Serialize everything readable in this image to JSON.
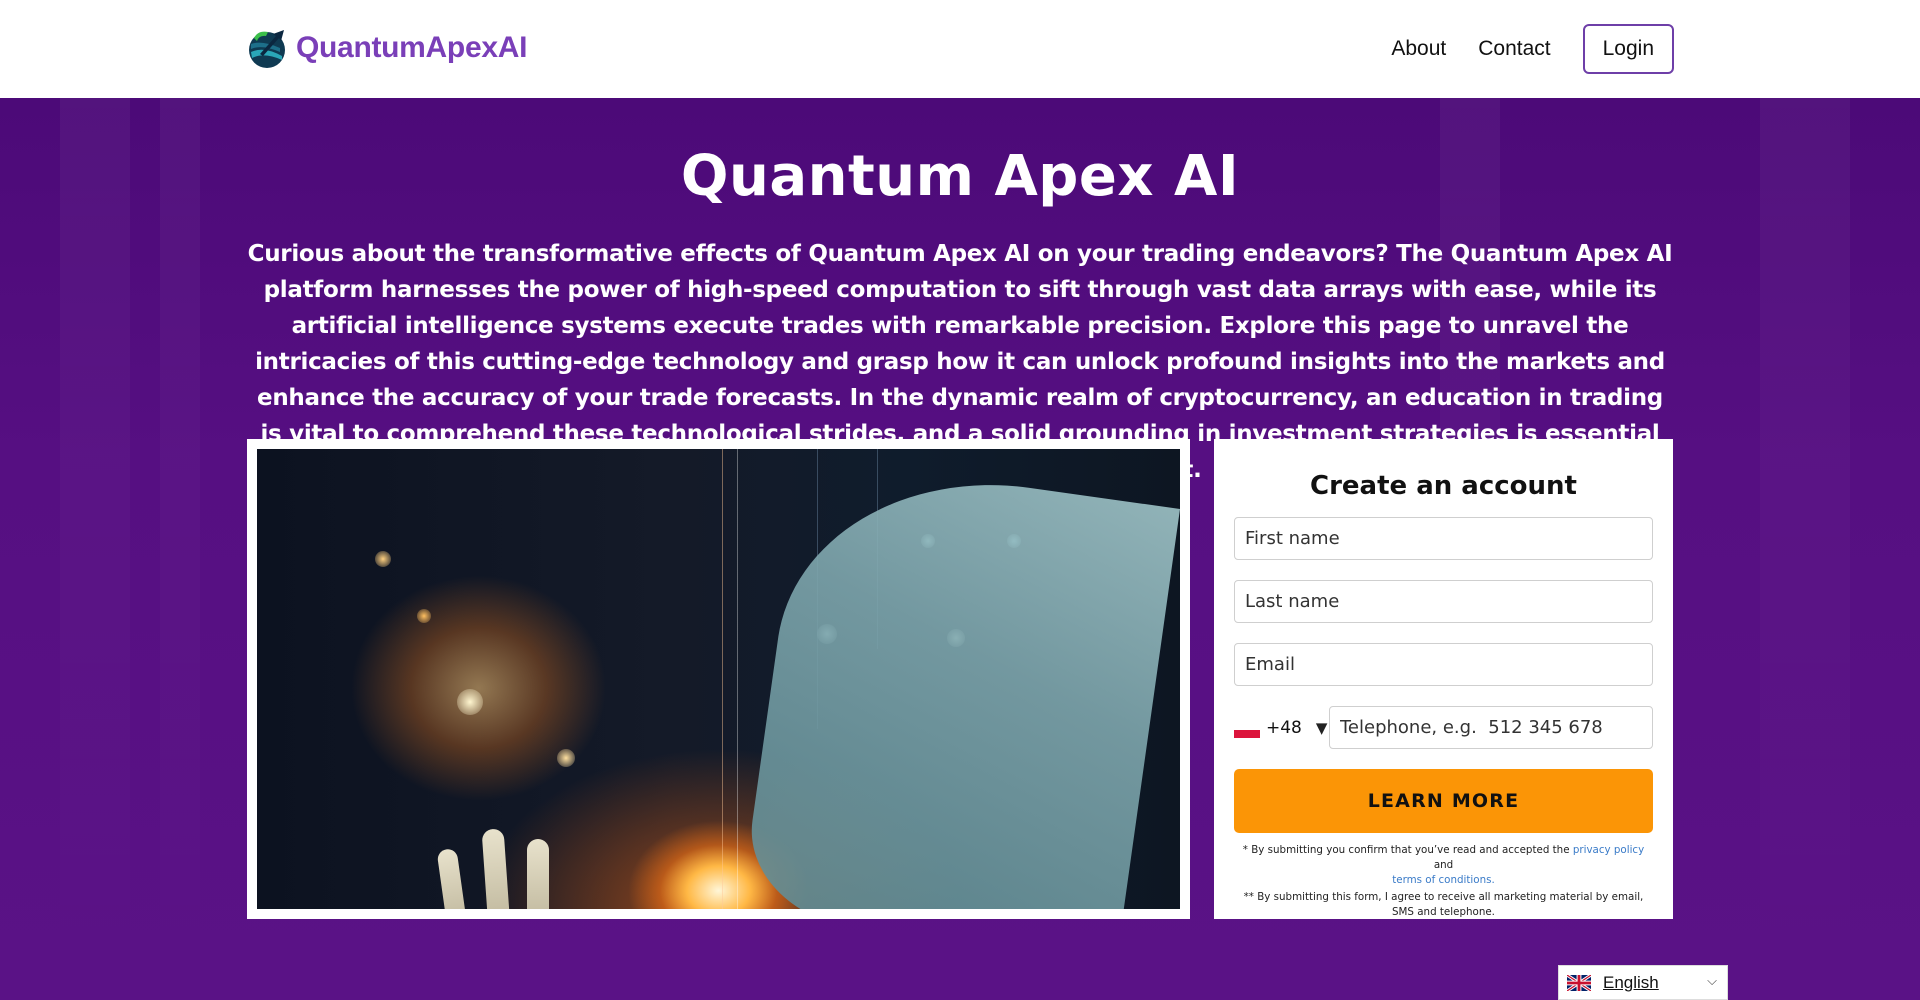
{
  "header": {
    "brand": "QuantumApexAI",
    "nav": [
      {
        "label": "About"
      },
      {
        "label": "Contact"
      }
    ],
    "login_label": "Login"
  },
  "hero": {
    "title": "Quantum Apex AI",
    "description": "Curious about the transformative effects of Quantum Apex AI on your trading endeavors? The Quantum Apex AI platform harnesses the power of high-speed computation to sift through vast data arrays with ease, while its artificial intelligence systems execute trades with remarkable precision. Explore this page to unravel the intricacies of this cutting-edge technology and grasp how it can unlock profound insights into the markets and enhance the accuracy of your trade forecasts. In the dynamic realm of cryptocurrency, an education in trading is vital to comprehend these technological strides, and a solid grounding in investment strategies is essential for capitalizing on them to the fullest."
  },
  "form": {
    "title": "Create an account",
    "first_name_placeholder": "First name",
    "last_name_placeholder": "Last name",
    "email_placeholder": "Email",
    "country_code": "+48",
    "country_caret": "▼",
    "phone_placeholder": "Telephone, e.g.  512 345 678",
    "submit_label": "LEARN MORE",
    "disclaimer1_prefix": "* By submitting you confirm that you’ve read and accepted the ",
    "privacy_link": "privacy policy",
    "disclaimer1_mid": " and ",
    "terms_link": "terms of conditions.",
    "disclaimer2": "** By submitting this form, I agree to receive all marketing material by email, SMS and telephone."
  },
  "language": {
    "selected": "English",
    "chevron": "⌵"
  },
  "colors": {
    "brand_purple": "#7a3fb8",
    "hero_bg": "#520d7e",
    "cta_orange": "#fb9506",
    "link_blue": "#3a7bc8"
  }
}
